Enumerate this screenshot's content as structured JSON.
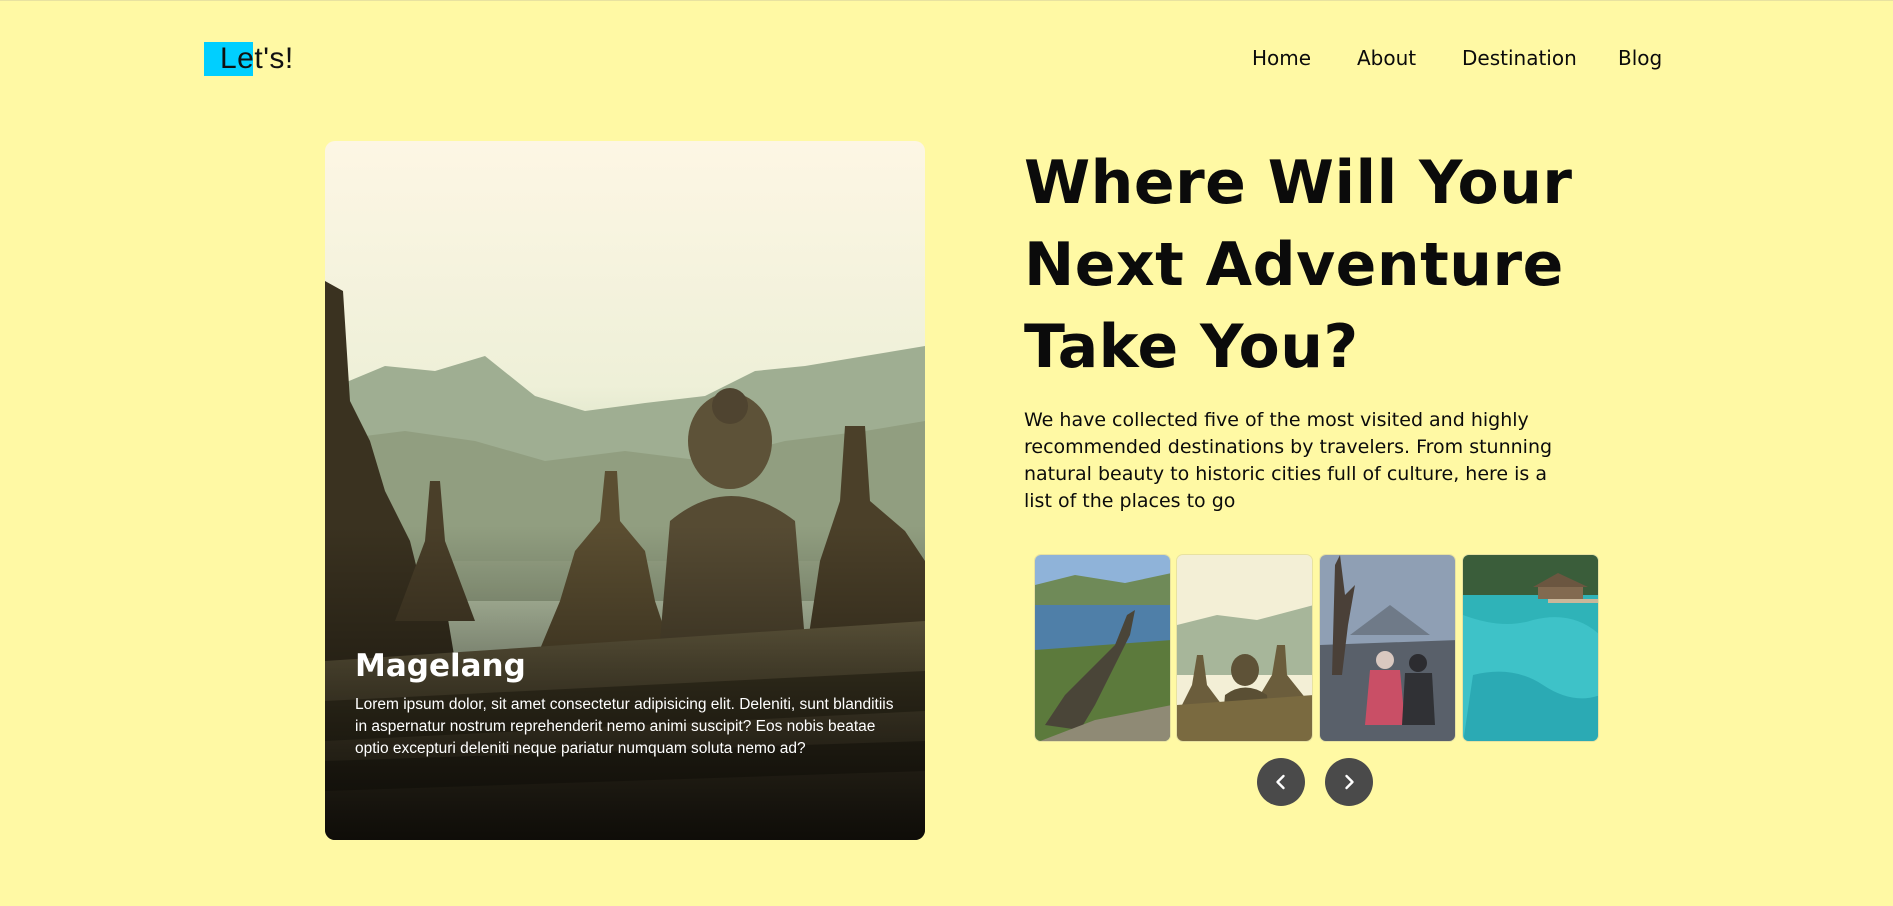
{
  "brand": {
    "logo_text": "Let's!",
    "accent": "#00cfff"
  },
  "nav": {
    "items": [
      "Home",
      "About",
      "Destination",
      "Blog"
    ]
  },
  "feature": {
    "title": "Magelang",
    "description": "Lorem ipsum dolor, sit amet consectetur adipisicing elit. Deleniti, sunt blanditiis in aspernatur nostrum reprehenderit nemo animi suscipit? Eos nobis beatae optio excepturi deleniti neque pariatur numquam soluta nemo ad?"
  },
  "hero": {
    "title_lines": [
      "Where Will Your",
      "Next Adventure",
      "Take You?"
    ],
    "description": "We have collected five of the most visited and highly recommended destinations by travelers. From stunning natural beauty to historic cities full of culture, here is a list of the places to go"
  },
  "carousel": {
    "prev_icon": "chevron-left-icon",
    "next_icon": "chevron-right-icon",
    "thumbnails": [
      "komodo-lizard-photo",
      "borobudur-stupa-photo",
      "mount-bromo-hikers-photo",
      "turquoise-sea-pier-photo"
    ]
  },
  "colors": {
    "background": "#fff9a4",
    "button": "#4a4a4a",
    "text": "#0b0b0b"
  }
}
